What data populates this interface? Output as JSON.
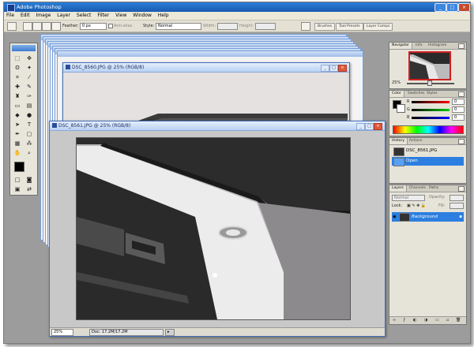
{
  "app": {
    "title": "Adobe Photoshop"
  },
  "menu": {
    "items": [
      "File",
      "Edit",
      "Image",
      "Layer",
      "Select",
      "Filter",
      "View",
      "Window",
      "Help"
    ]
  },
  "options_bar": {
    "feather_label": "Feather:",
    "feather_value": "0 px",
    "antialias_label": "Anti-alias",
    "style_label": "Style:",
    "style_value": "Normal",
    "width_label": "Width:",
    "height_label": "Height:",
    "palette_well": [
      "Brushes",
      "Tool Presets",
      "Layer Comps"
    ]
  },
  "documents": {
    "back": {
      "title": "DSC_8560.JPG @ 25% (RGB/8)"
    },
    "front": {
      "title": "DSC_8561.JPG @ 25% (RGB/8)",
      "zoom": "25%",
      "doc_size": "Doc: 17.2M/17.2M"
    }
  },
  "navigator": {
    "tabs": [
      "Navigator",
      "Info",
      "Histogram"
    ],
    "zoom": "25%"
  },
  "color_panel": {
    "tabs": [
      "Color",
      "Swatches",
      "Styles"
    ],
    "channels": [
      "R",
      "G",
      "B"
    ],
    "values": [
      "0",
      "0",
      "0"
    ]
  },
  "history_panel": {
    "tabs": [
      "History",
      "Actions"
    ],
    "snapshot": "DSC_8561.JPG",
    "step": "Open"
  },
  "layers_panel": {
    "tabs": [
      "Layers",
      "Channels",
      "Paths"
    ],
    "blend_mode": "Normal",
    "opacity_label": "Opacity:",
    "lock_label": "Lock:",
    "fill_label": "Fill:",
    "layer_name": "Background"
  },
  "icons": {
    "window_controls": [
      "minimize-icon",
      "maximize-icon",
      "close-icon"
    ],
    "lock": "lock-icon",
    "eye": "eye-icon"
  },
  "colors": {
    "title_bar": "#2a7fd8",
    "selection": "#2c7fe0",
    "workspace": "#9c9c9c",
    "close": "#c44a2a"
  }
}
